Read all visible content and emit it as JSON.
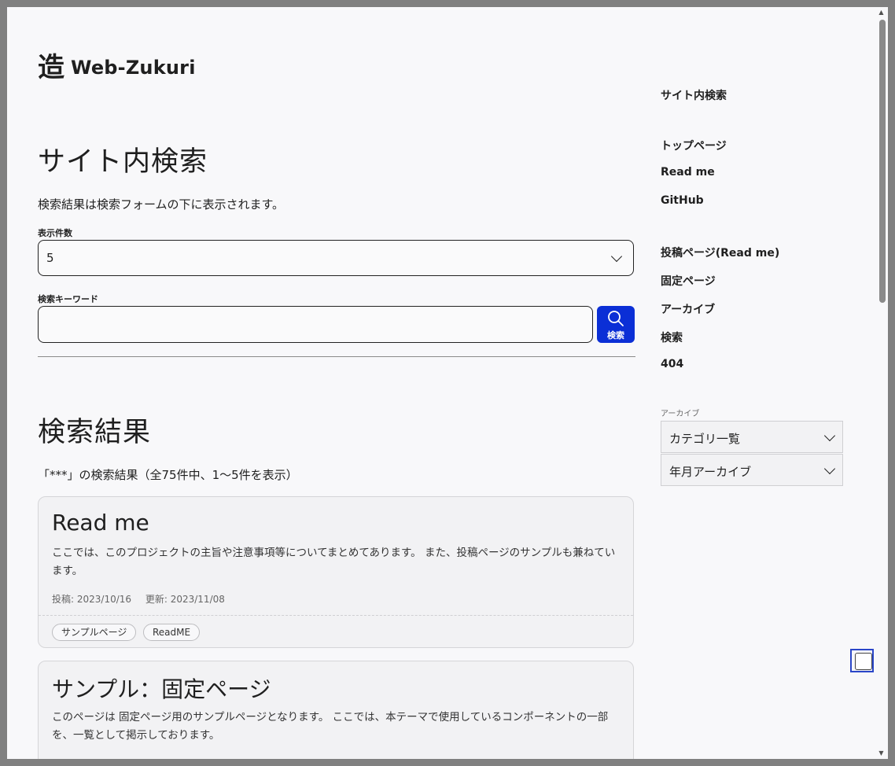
{
  "site": {
    "logo_mark": "造",
    "name": "Web-Zukuri"
  },
  "page": {
    "title": "サイト内検索",
    "intro": "検索結果は検索フォームの下に表示されます。"
  },
  "form": {
    "count_label": "表示件数",
    "count_value": "5",
    "keyword_label": "検索キーワード",
    "keyword_value": "",
    "search_button": "検索"
  },
  "results": {
    "title": "検索結果",
    "summary": "「***」の検索結果（全75件中、1〜5件を表示）",
    "items": [
      {
        "title": "Read me",
        "excerpt": "ここでは、このプロジェクトの主旨や注意事項等についてまとめてあります。 また、投稿ページのサンプルも兼ねています。",
        "posted": "投稿: 2023/10/16",
        "updated": "更新: 2023/11/08",
        "tags": [
          "サンプルページ",
          "ReadME"
        ]
      },
      {
        "title": "サンプル：固定ページ",
        "excerpt": "このページは 固定ページ用のサンプルページとなります。 ここでは、本テーマで使用しているコンポーネントの一部を、一覧として掲示しております。"
      }
    ]
  },
  "sidebar": {
    "links": [
      "サイト内検索",
      "トップページ",
      "Read me",
      "GitHub",
      "投稿ページ(Read me)",
      "固定ページ",
      "アーカイブ",
      "検索",
      "404"
    ],
    "archive_caption": "アーカイブ",
    "selects": [
      "カテゴリ一覧",
      "年月アーカイブ"
    ]
  },
  "icons": [
    "search-icon",
    "chevron-down-icon",
    "scroll-up-arrow-icon",
    "scroll-down-arrow-icon"
  ],
  "colors": {
    "accent": "#0b2fd6",
    "background": "#f8f8fa",
    "card": "#f2f2f4"
  }
}
